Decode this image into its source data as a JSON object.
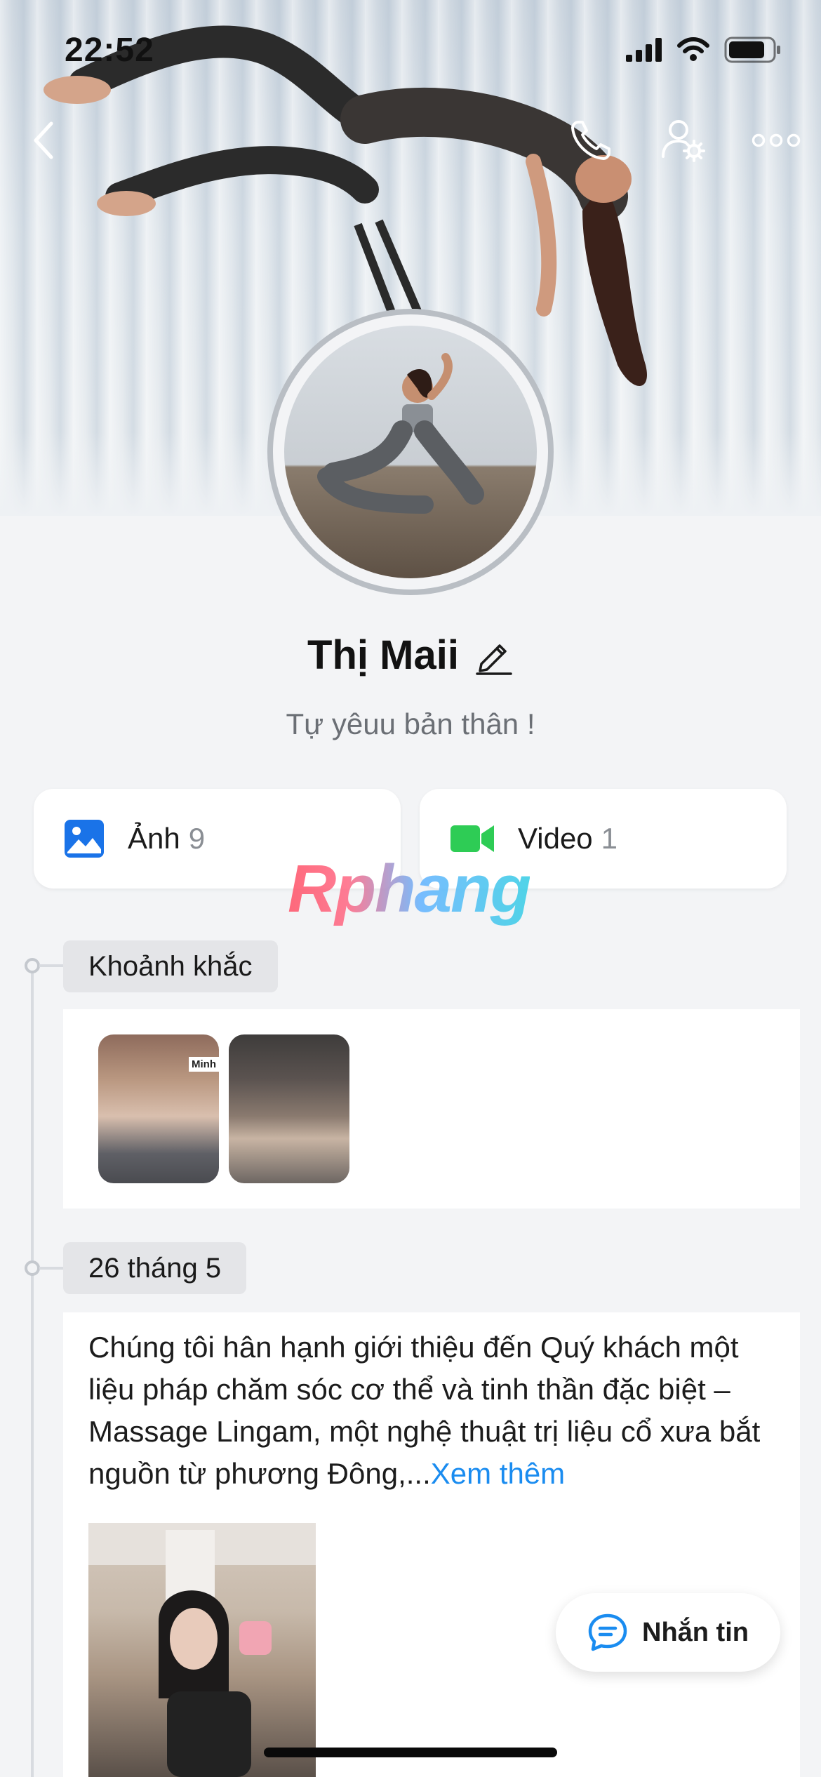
{
  "status_bar": {
    "time": "22:52"
  },
  "profile": {
    "name": "Thị Maii",
    "bio": "Tự yêuu bản thân !"
  },
  "media": {
    "photos_label": "Ảnh",
    "photos_count": "9",
    "videos_label": "Video",
    "videos_count": "1"
  },
  "watermark": "Rphang",
  "moments": {
    "title": "Khoảnh khắc",
    "thumbnails": [
      {
        "caption": "Minh"
      },
      {
        "caption": ""
      }
    ]
  },
  "post": {
    "date": "26 tháng 5",
    "text": "Chúng tôi hân hạnh giới thiệu đến Quý khách một liệu pháp chăm sóc cơ thể và tinh thần đặc biệt – Massage Lingam, một nghệ thuật trị liệu cổ xưa bắt nguồn từ phương Đông,...",
    "see_more": "Xem thêm"
  },
  "chat_button": {
    "label": "Nhắn tin"
  },
  "colors": {
    "accent": "#1a8cf0",
    "photo_icon": "#1a73e8",
    "video_icon": "#2ecc55",
    "background": "#f3f4f6"
  },
  "icons": {
    "back": "chevron-left-icon",
    "call": "phone-icon",
    "settings": "user-settings-icon",
    "more": "more-horizontal-icon",
    "edit": "pencil-icon",
    "photos": "image-icon",
    "videos": "video-camera-icon",
    "chat": "chat-bubble-icon"
  }
}
